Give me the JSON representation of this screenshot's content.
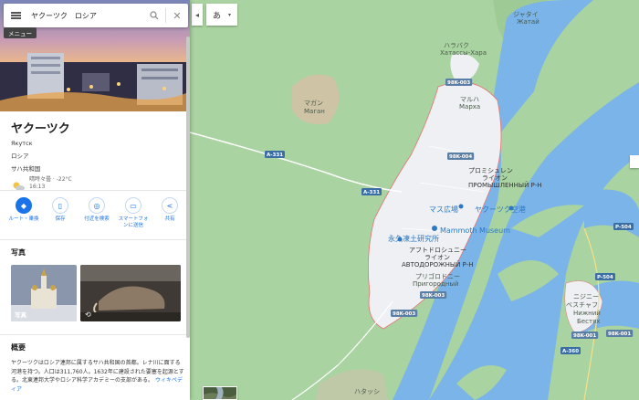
{
  "search": {
    "query": "ヤクーツク　ロシア"
  },
  "menu_tooltip": "メニュー",
  "place": {
    "title": "ヤクーツク",
    "native_name": "Якутск",
    "country": "ロシア",
    "region": "サハ共和国",
    "weather": {
      "condition": "晴時々曇 · -22°C",
      "time": "16:13"
    }
  },
  "actions": [
    {
      "label": "ルート・乗換",
      "icon": "directions-icon"
    },
    {
      "label": "保存",
      "icon": "bookmark-icon"
    },
    {
      "label": "付近を検索",
      "icon": "nearby-icon"
    },
    {
      "label": "スマートフォンに送信",
      "icon": "send-to-phone-icon"
    },
    {
      "label": "共有",
      "icon": "share-icon"
    }
  ],
  "photos": {
    "heading": "写真",
    "caption": "写真"
  },
  "overview": {
    "heading": "概要",
    "text": "ヤクーツクはロシア連邦に属するサハ共和国の首都。レナ川に面する河港を持つ。人口は311,760人。1632年に建設された要塞を起源とする。北東連邦大学やロシア科学アカデミーの支部がある。",
    "link": "ウィキペディア"
  },
  "map_controls": {
    "ime_label": "あ",
    "collapse_icon": "chevron-left-icon"
  },
  "map": {
    "labels": [
      {
        "text": "ジャタイ",
        "kind": "town"
      },
      {
        "text": "Жатай",
        "kind": "town"
      },
      {
        "text": "ハラバク",
        "kind": "town"
      },
      {
        "text": "Хатассы-Хара",
        "kind": "town"
      },
      {
        "text": "マガン",
        "kind": "town"
      },
      {
        "text": "Маган",
        "kind": "town"
      },
      {
        "text": "マルハ",
        "kind": "town"
      },
      {
        "text": "Марха",
        "kind": "town"
      },
      {
        "text": "プロミシュレン",
        "kind": "district"
      },
      {
        "text": "ライオン",
        "kind": "district"
      },
      {
        "text": "ПРОМЫШЛЕННЫЙ Р-Н",
        "kind": "district"
      },
      {
        "text": "アフトドロシュニー",
        "kind": "district"
      },
      {
        "text": "ライオン",
        "kind": "district"
      },
      {
        "text": "АВТОДОРОЖНЫЙ Р-Н",
        "kind": "district"
      },
      {
        "text": "プリゴロドニー",
        "kind": "town"
      },
      {
        "text": "Пригородный",
        "kind": "town"
      },
      {
        "text": "ニジニー",
        "kind": "town"
      },
      {
        "text": "ベスチャフ",
        "kind": "town"
      },
      {
        "text": "Нижний",
        "kind": "town"
      },
      {
        "text": "Бестях",
        "kind": "town"
      },
      {
        "text": "ハタッシ",
        "kind": "town"
      },
      {
        "text": "Mammoth Museum",
        "kind": "poi"
      },
      {
        "text": "永久凍土研究所",
        "kind": "poi"
      },
      {
        "text": "ヤクーツク空港",
        "kind": "poi"
      },
      {
        "text": "マス広場",
        "kind": "poi"
      }
    ],
    "shields": [
      "A-331",
      "A-331",
      "98K-003",
      "98K-004",
      "98K-003",
      "98K-003",
      "A-360",
      "P-504",
      "P-504",
      "98K-001",
      "98K-001"
    ]
  },
  "colors": {
    "water": "#7ab4e8",
    "land": "#a9d3a0",
    "city": "#eef0f3",
    "accent": "#1a73e8",
    "boundary": "#e57373"
  }
}
